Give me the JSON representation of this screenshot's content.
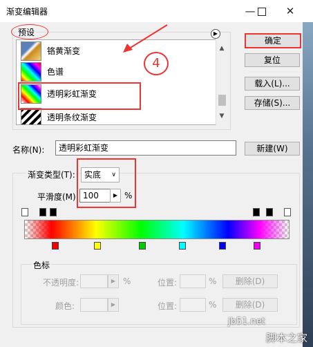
{
  "window": {
    "title": "渐变编辑器"
  },
  "presets": {
    "legend": "预设",
    "items": [
      {
        "label": "铬黄渐变"
      },
      {
        "label": "色谱"
      },
      {
        "label": "透明彩虹渐变"
      },
      {
        "label": "透明条纹渐变"
      }
    ]
  },
  "annotation": {
    "step": "4"
  },
  "buttons": {
    "ok": "确定",
    "reset": "复位",
    "load": "载入(L)...",
    "save": "存储(S)...",
    "new": "新建(W)"
  },
  "name": {
    "label": "名称(N):",
    "value": "透明彩虹渐变"
  },
  "gradient": {
    "type_label": "渐变类型(T):",
    "type_value": "实底",
    "smooth_label": "平滑度(M):",
    "smooth_value": "100",
    "smooth_unit": "%"
  },
  "color_stops": {
    "legend": "色标",
    "opacity_label": "不透明度:",
    "opacity_unit": "%",
    "location_label": "位置:",
    "location_unit": "%",
    "color_label": "颜色:",
    "delete_label": "删除(D)"
  },
  "watermark": {
    "site": "jb51.net",
    "logo": "脚本之家"
  },
  "colors": {
    "annotation_red": "#e33333"
  }
}
